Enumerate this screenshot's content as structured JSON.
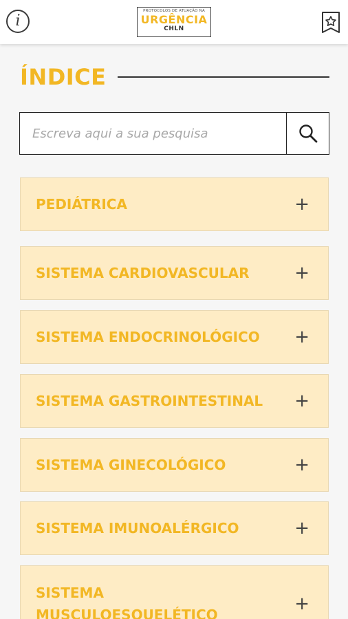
{
  "header": {
    "logo_top": "PROTOCOLOS DE ATUAÇÃO NA",
    "logo_main": "URGÊNCIA",
    "logo_sub": "CHLN",
    "info_glyph": "i",
    "info_icon": "info-icon",
    "bookmark_icon": "star-bookmark-icon"
  },
  "page": {
    "title": "ÍNDICE"
  },
  "search": {
    "placeholder": "Escreva aqui a sua pesquisa",
    "value": "",
    "icon": "search-icon"
  },
  "colors": {
    "accent": "#f2b724",
    "item_bg": "#feecc5",
    "background": "#f6f6f6"
  },
  "categories": [
    {
      "label": "PEDIÁTRICA",
      "expand": "+"
    },
    {
      "label": "SISTEMA CARDIOVASCULAR",
      "expand": "+"
    },
    {
      "label": "SISTEMA ENDOCRINOLÓGICO",
      "expand": "+"
    },
    {
      "label": "SISTEMA GASTROINTESTINAL",
      "expand": "+"
    },
    {
      "label": "SISTEMA GINECOLÓGICO",
      "expand": "+"
    },
    {
      "label": "SISTEMA IMUNOALÉRGICO",
      "expand": "+"
    },
    {
      "label": "SISTEMA MUSCULOESQUELÉTICO",
      "expand": "+"
    }
  ]
}
